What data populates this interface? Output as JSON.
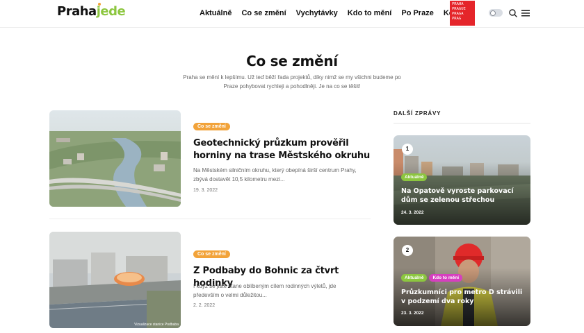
{
  "header": {
    "logo_part1": "Praha",
    "logo_part2": "jede",
    "nav": [
      "Aktuálně",
      "Co se změní",
      "Vychytávky",
      "Kdo to mění",
      "Po Praze",
      "Kontakt"
    ],
    "badge_lines": [
      "PRAHA",
      "PRAGUE",
      "PRAGA",
      "PRAG"
    ]
  },
  "page": {
    "title": "Co se změní",
    "intro": "Praha se mění k lepšímu. Už teď běží řada projektů, díky nimž se my všichni budeme po Praze pohybovat rychleji a pohodlněji. Je na co se těšit!"
  },
  "articles": [
    {
      "category": "Co se změní",
      "title": "Geotechnický průzkum prověřil horniny na trase Městského okruhu",
      "excerpt": "Na Městském silničním okruhu, který obepíná širší centrum Prahy, zbývá dostavět 10,5 kilometru mezi...",
      "date": "19. 3. 2022"
    },
    {
      "category": "Co se změní",
      "title": "Z Podbaby do Bohnic za čtvrt hodinky",
      "excerpt": "I když se jistě stane oblíbeným cílem rodinných výletů, jde především o velmi důležitou...",
      "date": "2. 2. 2022",
      "image_caption": "Vizualizace stanice Podbaba"
    }
  ],
  "sidebar": {
    "heading": "DALŠÍ ZPRÁVY",
    "cards": [
      {
        "number": "1",
        "tags": [
          "Aktuálně"
        ],
        "title": "Na Opatově vyroste parkovací dům se zelenou střechou",
        "date": "24. 3. 2022"
      },
      {
        "number": "2",
        "tags": [
          "Aktuálně",
          "Kdo to mění"
        ],
        "title": "Průzkumníci pro metro D strávili v podzemí dva roky",
        "date": "23. 3. 2022"
      }
    ]
  },
  "colors": {
    "accent_orange": "#f2a33a",
    "brand_green": "#8cc63f",
    "tag_pink": "#d63fbf",
    "badge_red": "#e5252a"
  }
}
